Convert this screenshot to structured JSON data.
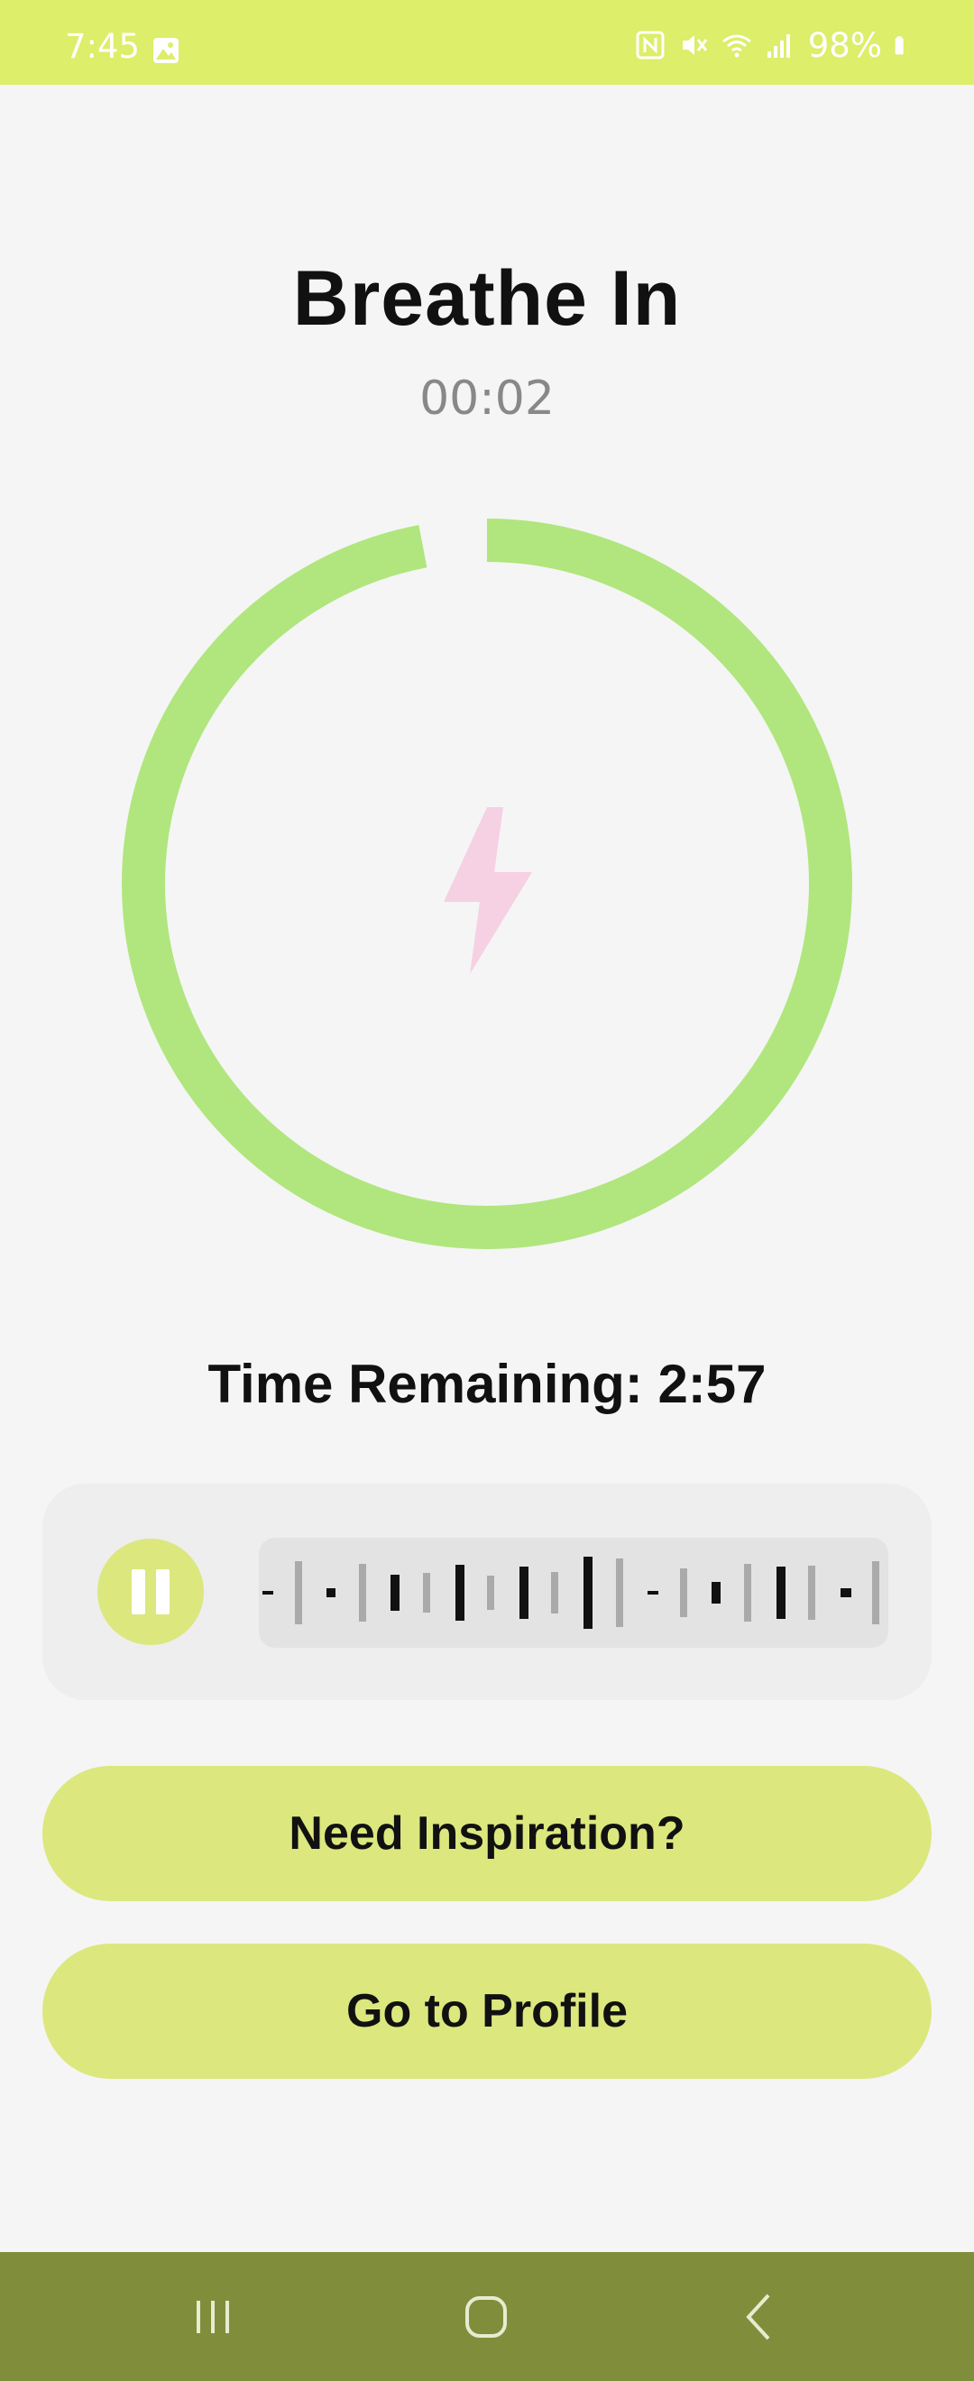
{
  "status_bar": {
    "time": "7:45",
    "battery": "98%",
    "icons": [
      "gallery-icon",
      "nfc-icon",
      "mute-icon",
      "wifi-icon",
      "signal-icon",
      "battery-icon"
    ]
  },
  "screen": {
    "title": "Breathe In",
    "timer": "00:02",
    "center_icon": "lightning-icon",
    "ring_progress": 0.97,
    "time_remaining": "Time Remaining: 2:57"
  },
  "audio": {
    "state_icon": "pause-icon",
    "waveform_icon": "waveform-icon"
  },
  "buttons": {
    "inspiration": "Need Inspiration?",
    "profile": "Go to Profile"
  },
  "nav": {
    "recents": "recents-icon",
    "home": "home-icon",
    "back": "back-icon"
  },
  "colors": {
    "status_bar": "#dcee6a",
    "ring": "#b0e67d",
    "accent_button": "#dce77e",
    "lightning": "#f6d0e3",
    "nav_bar": "#808e3b"
  }
}
